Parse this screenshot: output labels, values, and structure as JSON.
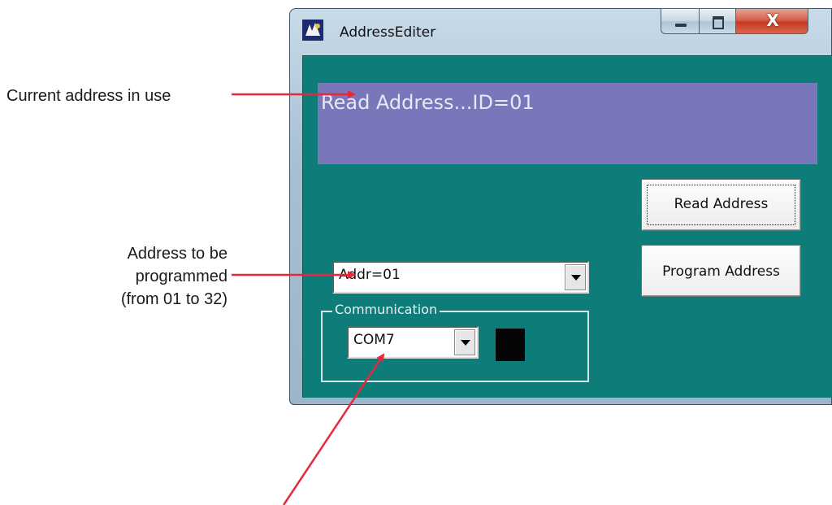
{
  "annotations": {
    "current_address": "Current address in use",
    "address_to_program": [
      "Address to be",
      "programmed",
      "(from 01 to 32)"
    ]
  },
  "window": {
    "title": "AddressEditer",
    "app_icon": "app-icon",
    "controls": {
      "minimize_icon": "minimize-icon",
      "maximize_icon": "maximize-icon",
      "close_glyph": "X"
    }
  },
  "display": {
    "text": "Read Address...ID=01"
  },
  "buttons": {
    "read_address": "Read Address",
    "program_address": "Program Address"
  },
  "address_combo": {
    "value": "Addr=01"
  },
  "communication": {
    "legend": "Communication",
    "port_value": "COM7",
    "status_color": "#050505"
  },
  "colors": {
    "client_background": "#0e7d7a",
    "display_background": "#7a76ba",
    "arrow": "#e8283a"
  }
}
